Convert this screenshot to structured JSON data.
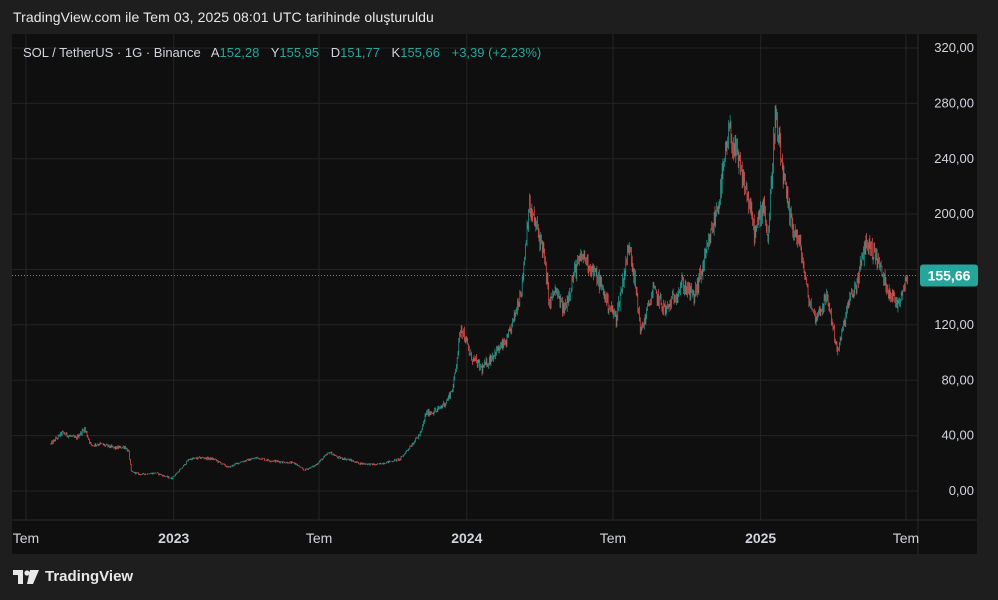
{
  "caption": "TradingView.com ile Tem 03, 2025 08:01 UTC tarihinde oluşturuldu",
  "legend": {
    "symbol": "SOL / TetherUS · 1G · Binance",
    "open_label": "A",
    "open": "152,28",
    "high_label": "Y",
    "high": "155,95",
    "low_label": "D",
    "low": "151,77",
    "close_label": "K",
    "close": "155,66",
    "change": "+3,39 (+2,23%)"
  },
  "brand": "TradingView",
  "colors": {
    "up": "#26a69a",
    "down": "#ef5350",
    "price_label_bg": "#26a69a",
    "background": "#0f0f0f",
    "grid": "#242424",
    "text": "#d1d4dc"
  },
  "chart_data": {
    "type": "candlestick",
    "x_range": [
      "2022-08",
      "2025-07-03"
    ],
    "ylim": [
      -15,
      330
    ],
    "y_ticks": [
      "320,00",
      "280,00",
      "240,00",
      "200,00",
      "160,00",
      "120,00",
      "80,00",
      "40,00",
      "0,00"
    ],
    "y_tick_values": [
      320,
      280,
      240,
      200,
      160,
      120,
      80,
      40,
      0
    ],
    "x_tick_labels": [
      "Tem",
      "2023",
      "Tem",
      "2024",
      "Tem",
      "2025",
      "Tem"
    ],
    "x_tick_dates": [
      "2022-07",
      "2023-01",
      "2023-07",
      "2024-01",
      "2024-07",
      "2025-01",
      "2025-07"
    ],
    "current_price": 155.66,
    "current_price_label": "155,66",
    "grid": true,
    "series": [
      {
        "price_path": [
          [
            "2022-08-01",
            34
          ],
          [
            "2022-08-15",
            42
          ],
          [
            "2022-09-01",
            38
          ],
          [
            "2022-09-12",
            45
          ],
          [
            "2022-09-20",
            33
          ],
          [
            "2022-10-01",
            34
          ],
          [
            "2022-10-20",
            31
          ],
          [
            "2022-11-01",
            32
          ],
          [
            "2022-11-06",
            28
          ],
          [
            "2022-11-09",
            14
          ],
          [
            "2022-11-20",
            12
          ],
          [
            "2022-12-10",
            13
          ],
          [
            "2022-12-29",
            9
          ],
          [
            "2023-01-10",
            16
          ],
          [
            "2023-01-20",
            23
          ],
          [
            "2023-02-05",
            24
          ],
          [
            "2023-02-20",
            23
          ],
          [
            "2023-03-10",
            17
          ],
          [
            "2023-03-25",
            21
          ],
          [
            "2023-04-15",
            24
          ],
          [
            "2023-05-01",
            22
          ],
          [
            "2023-06-01",
            20
          ],
          [
            "2023-06-12",
            15
          ],
          [
            "2023-06-25",
            18
          ],
          [
            "2023-07-14",
            28
          ],
          [
            "2023-07-25",
            24
          ],
          [
            "2023-08-05",
            23
          ],
          [
            "2023-08-20",
            20
          ],
          [
            "2023-09-10",
            19
          ],
          [
            "2023-09-25",
            21
          ],
          [
            "2023-10-10",
            23
          ],
          [
            "2023-10-22",
            32
          ],
          [
            "2023-11-05",
            42
          ],
          [
            "2023-11-11",
            56
          ],
          [
            "2023-11-25",
            58
          ],
          [
            "2023-12-07",
            65
          ],
          [
            "2023-12-15",
            75
          ],
          [
            "2023-12-25",
            120
          ],
          [
            "2024-01-05",
            98
          ],
          [
            "2024-01-20",
            88
          ],
          [
            "2024-02-05",
            100
          ],
          [
            "2024-02-20",
            108
          ],
          [
            "2024-02-29",
            125
          ],
          [
            "2024-03-10",
            150
          ],
          [
            "2024-03-18",
            205
          ],
          [
            "2024-03-28",
            190
          ],
          [
            "2024-04-05",
            175
          ],
          [
            "2024-04-13",
            135
          ],
          [
            "2024-04-20",
            145
          ],
          [
            "2024-05-01",
            130
          ],
          [
            "2024-05-15",
            160
          ],
          [
            "2024-05-25",
            170
          ],
          [
            "2024-06-05",
            160
          ],
          [
            "2024-06-15",
            150
          ],
          [
            "2024-06-25",
            135
          ],
          [
            "2024-07-05",
            125
          ],
          [
            "2024-07-22",
            180
          ],
          [
            "2024-08-05",
            115
          ],
          [
            "2024-08-20",
            145
          ],
          [
            "2024-09-05",
            130
          ],
          [
            "2024-09-25",
            150
          ],
          [
            "2024-10-10",
            140
          ],
          [
            "2024-10-25",
            170
          ],
          [
            "2024-11-10",
            210
          ],
          [
            "2024-11-23",
            260
          ],
          [
            "2024-12-05",
            235
          ],
          [
            "2024-12-15",
            215
          ],
          [
            "2024-12-25",
            185
          ],
          [
            "2025-01-05",
            210
          ],
          [
            "2025-01-10",
            180
          ],
          [
            "2025-01-19",
            270
          ],
          [
            "2025-01-25",
            245
          ],
          [
            "2025-02-05",
            200
          ],
          [
            "2025-02-20",
            175
          ],
          [
            "2025-03-01",
            140
          ],
          [
            "2025-03-10",
            125
          ],
          [
            "2025-03-25",
            140
          ],
          [
            "2025-04-07",
            100
          ],
          [
            "2025-04-20",
            135
          ],
          [
            "2025-05-01",
            150
          ],
          [
            "2025-05-12",
            180
          ],
          [
            "2025-05-25",
            170
          ],
          [
            "2025-06-05",
            150
          ],
          [
            "2025-06-20",
            135
          ],
          [
            "2025-07-03",
            155.66
          ]
        ]
      }
    ]
  }
}
